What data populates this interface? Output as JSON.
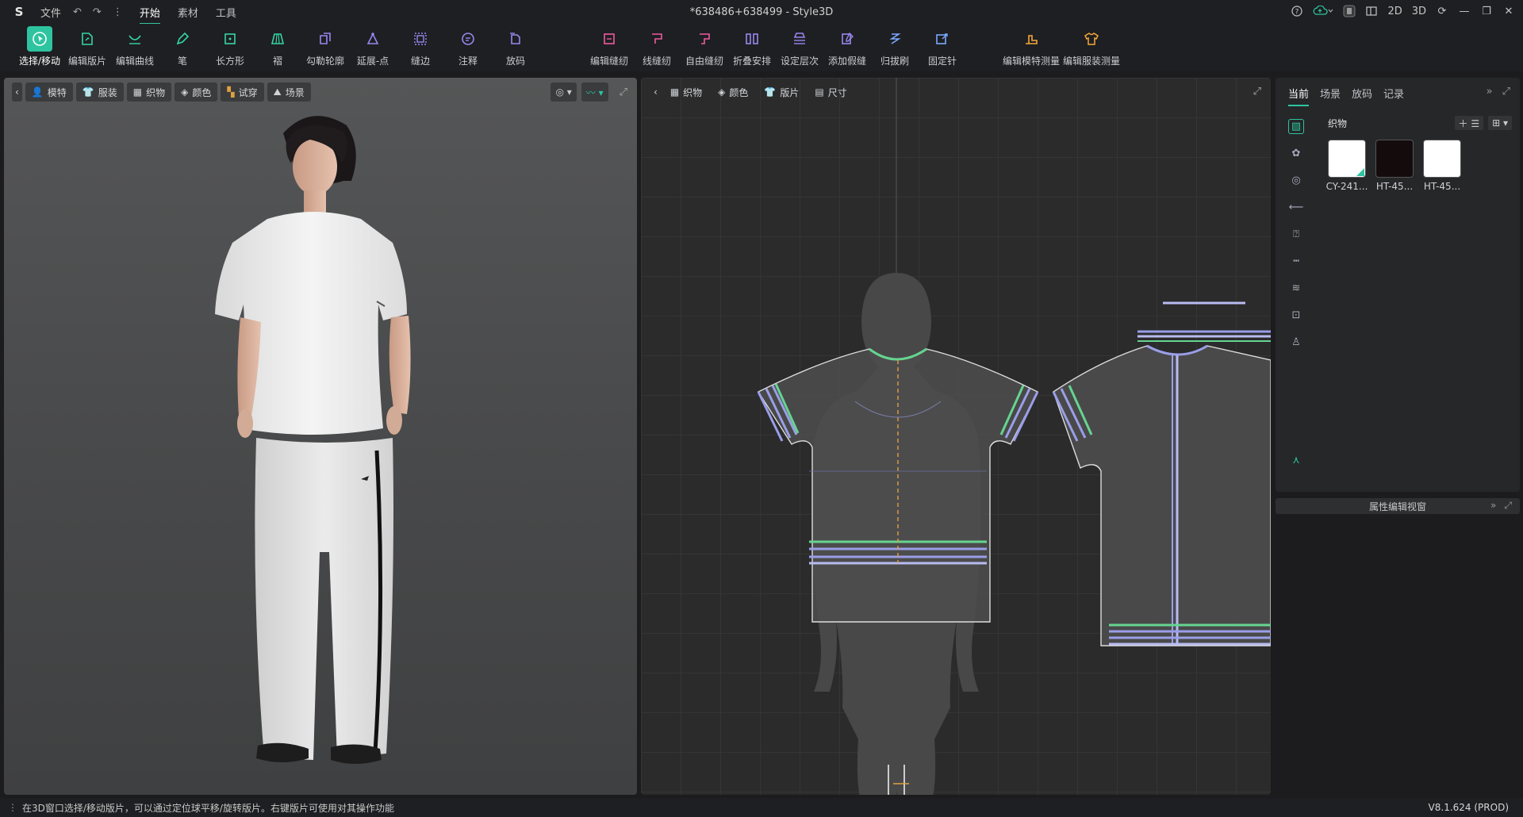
{
  "app": {
    "doc_title": "*638486+638499 - Style3D",
    "menu": [
      "文件"
    ],
    "tabs": [
      {
        "label": "开始",
        "active": true
      },
      {
        "label": "素材",
        "active": false
      },
      {
        "label": "工具",
        "active": false
      }
    ],
    "view_modes": [
      "2D",
      "3D"
    ]
  },
  "toolbar": {
    "tools": [
      {
        "label": "选择/移动",
        "icon": "select-move-icon",
        "group": "green",
        "active": true
      },
      {
        "label": "编辑版片",
        "icon": "edit-pattern-icon",
        "group": "green"
      },
      {
        "label": "编辑曲线",
        "icon": "edit-curve-icon",
        "group": "green"
      },
      {
        "label": "笔",
        "icon": "pen-icon",
        "group": "green"
      },
      {
        "label": "长方形",
        "icon": "rectangle-icon",
        "group": "green"
      },
      {
        "label": "褶",
        "icon": "pleat-icon",
        "group": "green"
      },
      {
        "label": "勾勒轮廓",
        "icon": "trace-outline-icon",
        "group": "purple"
      },
      {
        "label": "延展-点",
        "icon": "extend-point-icon",
        "group": "purple"
      },
      {
        "label": "缝边",
        "icon": "seam-allowance-icon",
        "group": "purple"
      },
      {
        "label": "注释",
        "icon": "annotation-icon",
        "group": "purple"
      },
      {
        "label": "放码",
        "icon": "grading-icon",
        "group": "purple"
      },
      {
        "label": "编辑缝纫",
        "icon": "edit-sewing-icon",
        "group": "pink"
      },
      {
        "label": "线缝纫",
        "icon": "line-sewing-icon",
        "group": "pink"
      },
      {
        "label": "自由缝纫",
        "icon": "free-sewing-icon",
        "group": "pink"
      },
      {
        "label": "折叠安排",
        "icon": "fold-arrange-icon",
        "group": "purple"
      },
      {
        "label": "设定层次",
        "icon": "set-layer-icon",
        "group": "purple"
      },
      {
        "label": "添加假缝",
        "icon": "add-tack-icon",
        "group": "purple"
      },
      {
        "label": "归拔刷",
        "icon": "shrink-brush-icon",
        "group": "blue"
      },
      {
        "label": "固定针",
        "icon": "pin-icon",
        "group": "blue"
      },
      {
        "label": "编辑模特测量",
        "icon": "avatar-measure-icon",
        "group": "orange"
      },
      {
        "label": "编辑服装测量",
        "icon": "garment-measure-icon",
        "group": "orange"
      }
    ]
  },
  "view3d": {
    "tabs": [
      {
        "label": "模特",
        "icon": "avatar-icon"
      },
      {
        "label": "服装",
        "icon": "garment-icon"
      },
      {
        "label": "织物",
        "icon": "fabric-icon"
      },
      {
        "label": "颜色",
        "icon": "color-icon"
      },
      {
        "label": "试穿",
        "icon": "fitting-icon"
      },
      {
        "label": "场景",
        "icon": "scene-icon"
      }
    ]
  },
  "view2d": {
    "tabs": [
      {
        "label": "织物",
        "icon": "fabric-icon"
      },
      {
        "label": "颜色",
        "icon": "color-icon"
      },
      {
        "label": "版片",
        "icon": "pattern-icon"
      },
      {
        "label": "尺寸",
        "icon": "size-icon"
      }
    ]
  },
  "right_panel": {
    "tabs": [
      {
        "label": "当前",
        "active": true
      },
      {
        "label": "场景",
        "active": false
      },
      {
        "label": "放码",
        "active": false
      },
      {
        "label": "记录",
        "active": false
      }
    ],
    "section_title": "织物",
    "fabrics": [
      {
        "name": "CY-241...",
        "color": "#ffffff"
      },
      {
        "name": "HT-45...",
        "color": "#140c0c"
      },
      {
        "name": "HT-45...",
        "color": "#ffffff"
      }
    ],
    "property_bar": "属性编辑视窗"
  },
  "status": {
    "message": "在3D窗口选择/移动版片，可以通过定位球平移/旋转版片。右键版片可使用对其操作功能",
    "version": "V8.1.624 (PROD)"
  },
  "colors": {
    "accent": "#2ec4a0",
    "background": "#1c1c1e"
  }
}
